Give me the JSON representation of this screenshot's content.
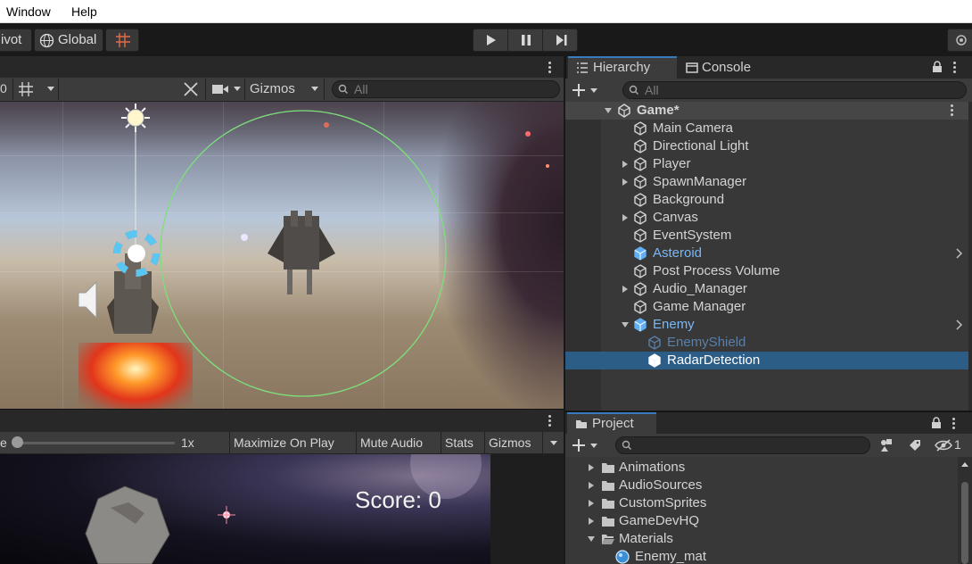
{
  "menubar": {
    "items": [
      "Window",
      "Help"
    ]
  },
  "toolbar": {
    "pivot": "ivot",
    "global": "Global"
  },
  "scene": {
    "zoom_value": "0",
    "gizmos": "Gizmos",
    "search_placeholder": "All"
  },
  "game": {
    "scale_label": "e",
    "scale_value": "1x",
    "buttons": [
      "Maximize On Play",
      "Mute Audio",
      "Stats",
      "Gizmos"
    ],
    "score_text": "Score: 0"
  },
  "hierarchy": {
    "tabs": [
      "Hierarchy",
      "Console"
    ],
    "search_placeholder": "All",
    "scene_name": "Game*",
    "items": [
      {
        "label": "Main Camera",
        "style": "normal",
        "expandable": false
      },
      {
        "label": "Directional Light",
        "style": "normal",
        "expandable": false
      },
      {
        "label": "Player",
        "style": "normal",
        "expandable": true
      },
      {
        "label": "SpawnManager",
        "style": "normal",
        "expandable": true
      },
      {
        "label": "Background",
        "style": "normal",
        "expandable": false
      },
      {
        "label": "Canvas",
        "style": "normal",
        "expandable": true
      },
      {
        "label": "EventSystem",
        "style": "normal",
        "expandable": false
      },
      {
        "label": "Asteroid",
        "style": "prefab",
        "expandable": false
      },
      {
        "label": "Post Process Volume",
        "style": "normal",
        "expandable": false
      },
      {
        "label": "Audio_Manager",
        "style": "normal",
        "expandable": true
      },
      {
        "label": "Game Manager",
        "style": "normal",
        "expandable": false
      },
      {
        "label": "Enemy",
        "style": "prefab",
        "expandable": true,
        "expanded": true
      },
      {
        "label": "EnemyShield",
        "style": "prefab-dim",
        "expandable": false
      },
      {
        "label": "RadarDetection",
        "style": "selected",
        "expandable": false
      }
    ]
  },
  "project": {
    "tab": "Project",
    "hidden_count": "1",
    "folders": [
      {
        "label": "Animations",
        "expanded": false
      },
      {
        "label": "AudioSources",
        "expanded": false
      },
      {
        "label": "CustomSprites",
        "expanded": false
      },
      {
        "label": "GameDevHQ",
        "expanded": false
      },
      {
        "label": "Materials",
        "expanded": true
      }
    ],
    "assets": [
      {
        "label": "Enemy_mat"
      }
    ]
  },
  "colors": {
    "selection": "#2c5d87",
    "prefab_text": "#7bb7f4",
    "radar_circle": "#7de07b"
  }
}
